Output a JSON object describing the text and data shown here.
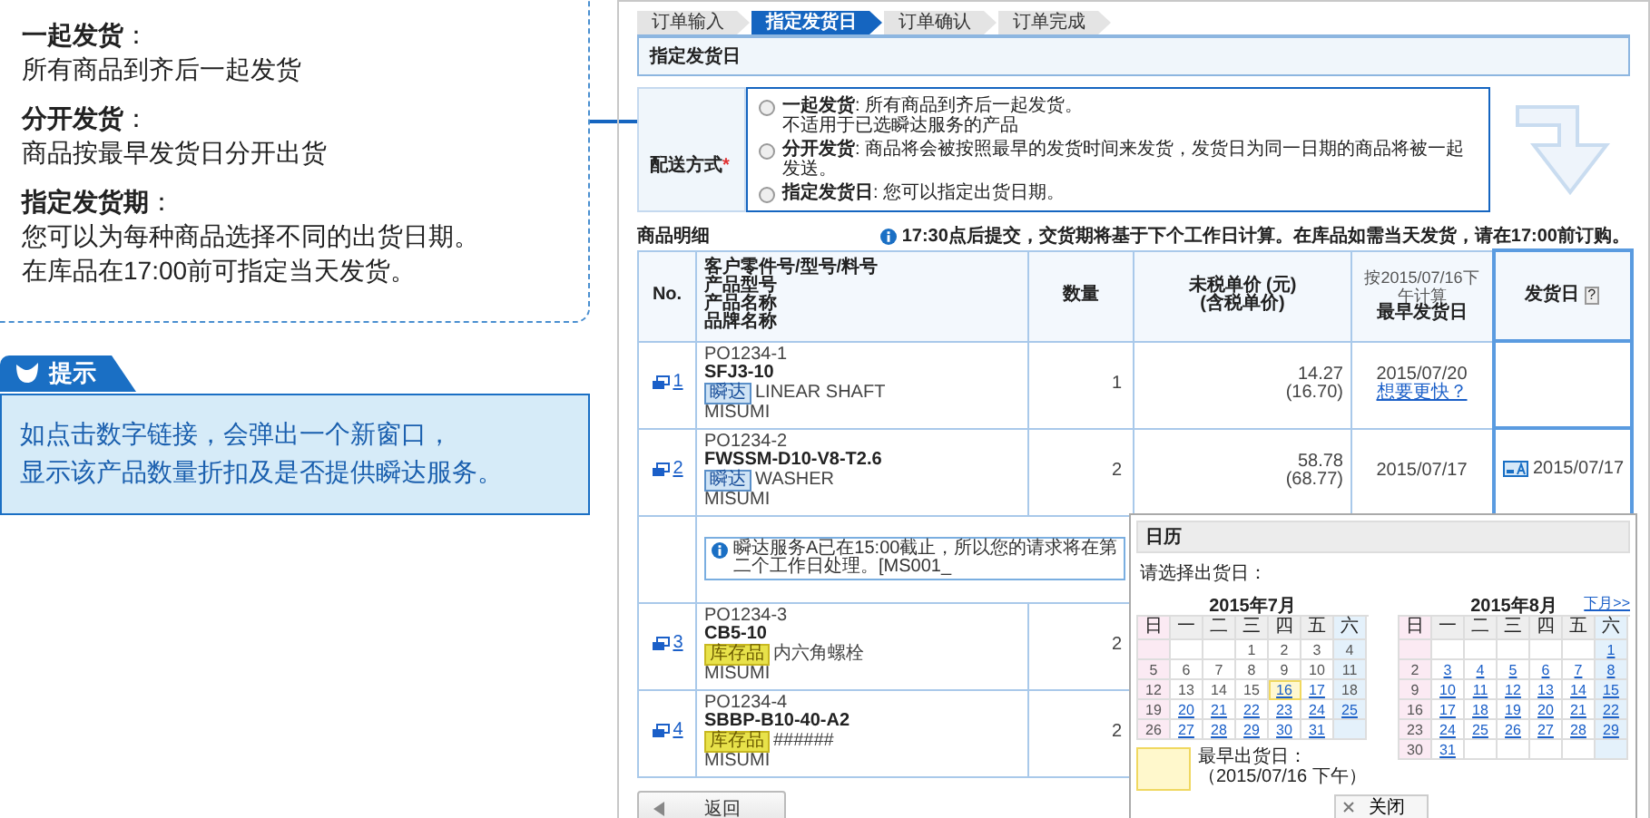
{
  "guide": {
    "items": [
      {
        "term": "**一起发货**：",
        "lines": [
          "所有商品到齐后一起发货"
        ]
      },
      {
        "term": "**分开发货**：",
        "lines": [
          "商品按最早发货日分开出货"
        ]
      },
      {
        "term": "**指定发货期**：",
        "lines": [
          "您可以为每种商品选择不同的出货日期。",
          "在库品在17:00前可指定当天发货。"
        ]
      }
    ]
  },
  "tip": {
    "title": "提示",
    "lines": [
      "如点击数字链接，会弹出一个新窗口，",
      "显示该产品数量折扣及是否提供瞬达服务。"
    ]
  },
  "screen": {
    "steps": [
      {
        "label": "订单输入",
        "selected": false
      },
      {
        "label": "指定发货日",
        "selected": true
      },
      {
        "label": "订单确认",
        "selected": false
      },
      {
        "label": "订单完成",
        "selected": false
      }
    ],
    "section_title": "指定发货日",
    "delivery": {
      "label": "配送方式",
      "required_mark": "*",
      "options": [
        {
          "text": "**一起发货**: 所有商品到齐后一起发货。",
          "note": "不适用于已选瞬达服务的产品",
          "selected": false
        },
        {
          "text": "**分开发货**: 商品将会被按照最早的发货时间来发货，发货日为同一日期的商品将被一起发送。",
          "selected": false
        },
        {
          "text": "**指定发货日**: 您可以指定出货日期。",
          "selected": false
        }
      ]
    },
    "table": {
      "title": "商品明细",
      "notice": "17:30点后提交，交货期将基于下个工作日计算。在库品如需当天发货，请在17:00前订购。",
      "columns": [
        {
          "lines": [
            "No."
          ]
        },
        {
          "lines": [
            "客户零件号/型号/料号",
            "产品型号",
            "产品名称",
            "品牌名称"
          ]
        },
        {
          "lines": [
            "数量"
          ]
        },
        {
          "lines": [
            "未税单价 (元)",
            "(含税单价)"
          ]
        },
        {
          "note": "按2015/07/16下午计算",
          "lines": [
            "最早发货日"
          ]
        },
        {
          "lines": [
            "发货日"
          ],
          "help": "?"
        }
      ],
      "rows": [
        {
          "no": "1",
          "customer_no": "PO1234-1",
          "model": "SFJ3-10",
          "tag": {
            "label": "瞬达",
            "kind": "express"
          },
          "name": "LINEAR SHAFT",
          "brand": "MISUMI",
          "quantity": "1",
          "price": "14.27",
          "price_tax": "(16.70)",
          "earliest": "2015/07/20",
          "faster_link": "想要更快？"
        },
        {
          "no": "2",
          "customer_no": "PO1234-2",
          "model": "FWSSM-D10-V8-T2.6",
          "tag": {
            "label": "瞬达",
            "kind": "express"
          },
          "name": "WASHER",
          "brand": "MISUMI",
          "quantity": "2",
          "price": "58.78",
          "price_tax": "(68.77)",
          "earliest": "2015/07/17",
          "ship_date": "2015/07/17",
          "alert": "瞬达服务A已在15:00截止，所以您的请求将在第二个工作日处理。[MS001_"
        },
        {
          "no": "3",
          "customer_no": "PO1234-3",
          "model": "CB5-10",
          "tag": {
            "label": "库存品",
            "kind": "stock"
          },
          "name": "内六角螺栓",
          "brand": "MISUMI",
          "quantity": "2"
        },
        {
          "no": "4",
          "customer_no": "PO1234-4",
          "model": "SBBP-B10-40-A2",
          "tag": {
            "label": "库存品",
            "kind": "stock"
          },
          "name": "######",
          "brand": "MISUMI",
          "quantity": "2"
        }
      ]
    },
    "back_button": "返回",
    "calendar": {
      "title": "日历",
      "prompt": "请选择出货日：",
      "next_link": "下月>>",
      "legend_label": "最早出货日：",
      "legend_note": "（2015/07/16 下午）",
      "close_button": "关闭",
      "months": [
        {
          "title": "2015年7月",
          "weekdays": [
            "日",
            "一",
            "二",
            "三",
            "四",
            "五",
            "六"
          ],
          "weeks": [
            {
              "kind": "lead",
              "days": [
                {
                  "label": "1",
                  "link": false,
                  "selected": false
                },
                {
                  "label": "2",
                  "link": false,
                  "selected": false
                },
                {
                  "label": "3",
                  "link": false,
                  "selected": false
                },
                {
                  "label": "4",
                  "link": false,
                  "selected": false
                }
              ]
            },
            {
              "kind": "full",
              "days": [
                {
                  "label": "5",
                  "link": false,
                  "selected": false
                },
                {
                  "label": "6",
                  "link": false,
                  "selected": false
                },
                {
                  "label": "7",
                  "link": false,
                  "selected": false
                },
                {
                  "label": "8",
                  "link": false,
                  "selected": false
                },
                {
                  "label": "9",
                  "link": false,
                  "selected": false
                },
                {
                  "label": "10",
                  "link": false,
                  "selected": false
                },
                {
                  "label": "11",
                  "link": false,
                  "selected": false
                }
              ]
            },
            {
              "kind": "full",
              "days": [
                {
                  "label": "12",
                  "link": false,
                  "selected": false
                },
                {
                  "label": "13",
                  "link": false,
                  "selected": false
                },
                {
                  "label": "14",
                  "link": false,
                  "selected": false
                },
                {
                  "label": "15",
                  "link": false,
                  "selected": false
                },
                {
                  "label": "16",
                  "link": true,
                  "selected": true
                },
                {
                  "label": "17",
                  "link": true,
                  "selected": false
                },
                {
                  "label": "18",
                  "link": false,
                  "selected": false
                }
              ]
            },
            {
              "kind": "full",
              "days": [
                {
                  "label": "19",
                  "link": false,
                  "selected": false
                },
                {
                  "label": "20",
                  "link": true,
                  "selected": false
                },
                {
                  "label": "21",
                  "link": true,
                  "selected": false
                },
                {
                  "label": "22",
                  "link": true,
                  "selected": false
                },
                {
                  "label": "23",
                  "link": true,
                  "selected": false
                },
                {
                  "label": "24",
                  "link": true,
                  "selected": false
                },
                {
                  "label": "25",
                  "link": true,
                  "selected": false
                }
              ]
            },
            {
              "kind": "tail",
              "days": [
                {
                  "label": "26",
                  "link": false,
                  "selected": false
                },
                {
                  "label": "27",
                  "link": true,
                  "selected": false
                },
                {
                  "label": "28",
                  "link": true,
                  "selected": false
                },
                {
                  "label": "29",
                  "link": true,
                  "selected": false
                },
                {
                  "label": "30",
                  "link": true,
                  "selected": false
                },
                {
                  "label": "31",
                  "link": true,
                  "selected": false
                }
              ]
            }
          ]
        },
        {
          "title": "2015年8月",
          "weekdays": [
            "日",
            "一",
            "二",
            "三",
            "四",
            "五",
            "六"
          ],
          "weeks": [
            {
              "kind": "lead",
              "days": [
                {
                  "label": "1",
                  "link": true,
                  "selected": false
                }
              ]
            },
            {
              "kind": "full",
              "days": [
                {
                  "label": "2",
                  "link": false,
                  "selected": false
                },
                {
                  "label": "3",
                  "link": true,
                  "selected": false
                },
                {
                  "label": "4",
                  "link": true,
                  "selected": false
                },
                {
                  "label": "5",
                  "link": true,
                  "selected": false
                },
                {
                  "label": "6",
                  "link": true,
                  "selected": false
                },
                {
                  "label": "7",
                  "link": true,
                  "selected": false
                },
                {
                  "label": "8",
                  "link": true,
                  "selected": false
                }
              ]
            },
            {
              "kind": "full",
              "days": [
                {
                  "label": "9",
                  "link": false,
                  "selected": false
                },
                {
                  "label": "10",
                  "link": true,
                  "selected": false
                },
                {
                  "label": "11",
                  "link": true,
                  "selected": false
                },
                {
                  "label": "12",
                  "link": true,
                  "selected": false
                },
                {
                  "label": "13",
                  "link": true,
                  "selected": false
                },
                {
                  "label": "14",
                  "link": true,
                  "selected": false
                },
                {
                  "label": "15",
                  "link": true,
                  "selected": false
                }
              ]
            },
            {
              "kind": "full",
              "days": [
                {
                  "label": "16",
                  "link": false,
                  "selected": false
                },
                {
                  "label": "17",
                  "link": true,
                  "selected": false
                },
                {
                  "label": "18",
                  "link": true,
                  "selected": false
                },
                {
                  "label": "19",
                  "link": true,
                  "selected": false
                },
                {
                  "label": "20",
                  "link": true,
                  "selected": false
                },
                {
                  "label": "21",
                  "link": true,
                  "selected": false
                },
                {
                  "label": "22",
                  "link": true,
                  "selected": false
                }
              ]
            },
            {
              "kind": "full",
              "days": [
                {
                  "label": "23",
                  "link": false,
                  "selected": false
                },
                {
                  "label": "24",
                  "link": true,
                  "selected": false
                },
                {
                  "label": "25",
                  "link": true,
                  "selected": false
                },
                {
                  "label": "26",
                  "link": true,
                  "selected": false
                },
                {
                  "label": "27",
                  "link": true,
                  "selected": false
                },
                {
                  "label": "28",
                  "link": true,
                  "selected": false
                },
                {
                  "label": "29",
                  "link": true,
                  "selected": false
                }
              ]
            },
            {
              "kind": "tail",
              "days": [
                {
                  "label": "30",
                  "link": false,
                  "selected": false
                },
                {
                  "label": "31",
                  "link": true,
                  "selected": false
                }
              ]
            }
          ]
        }
      ]
    }
  }
}
